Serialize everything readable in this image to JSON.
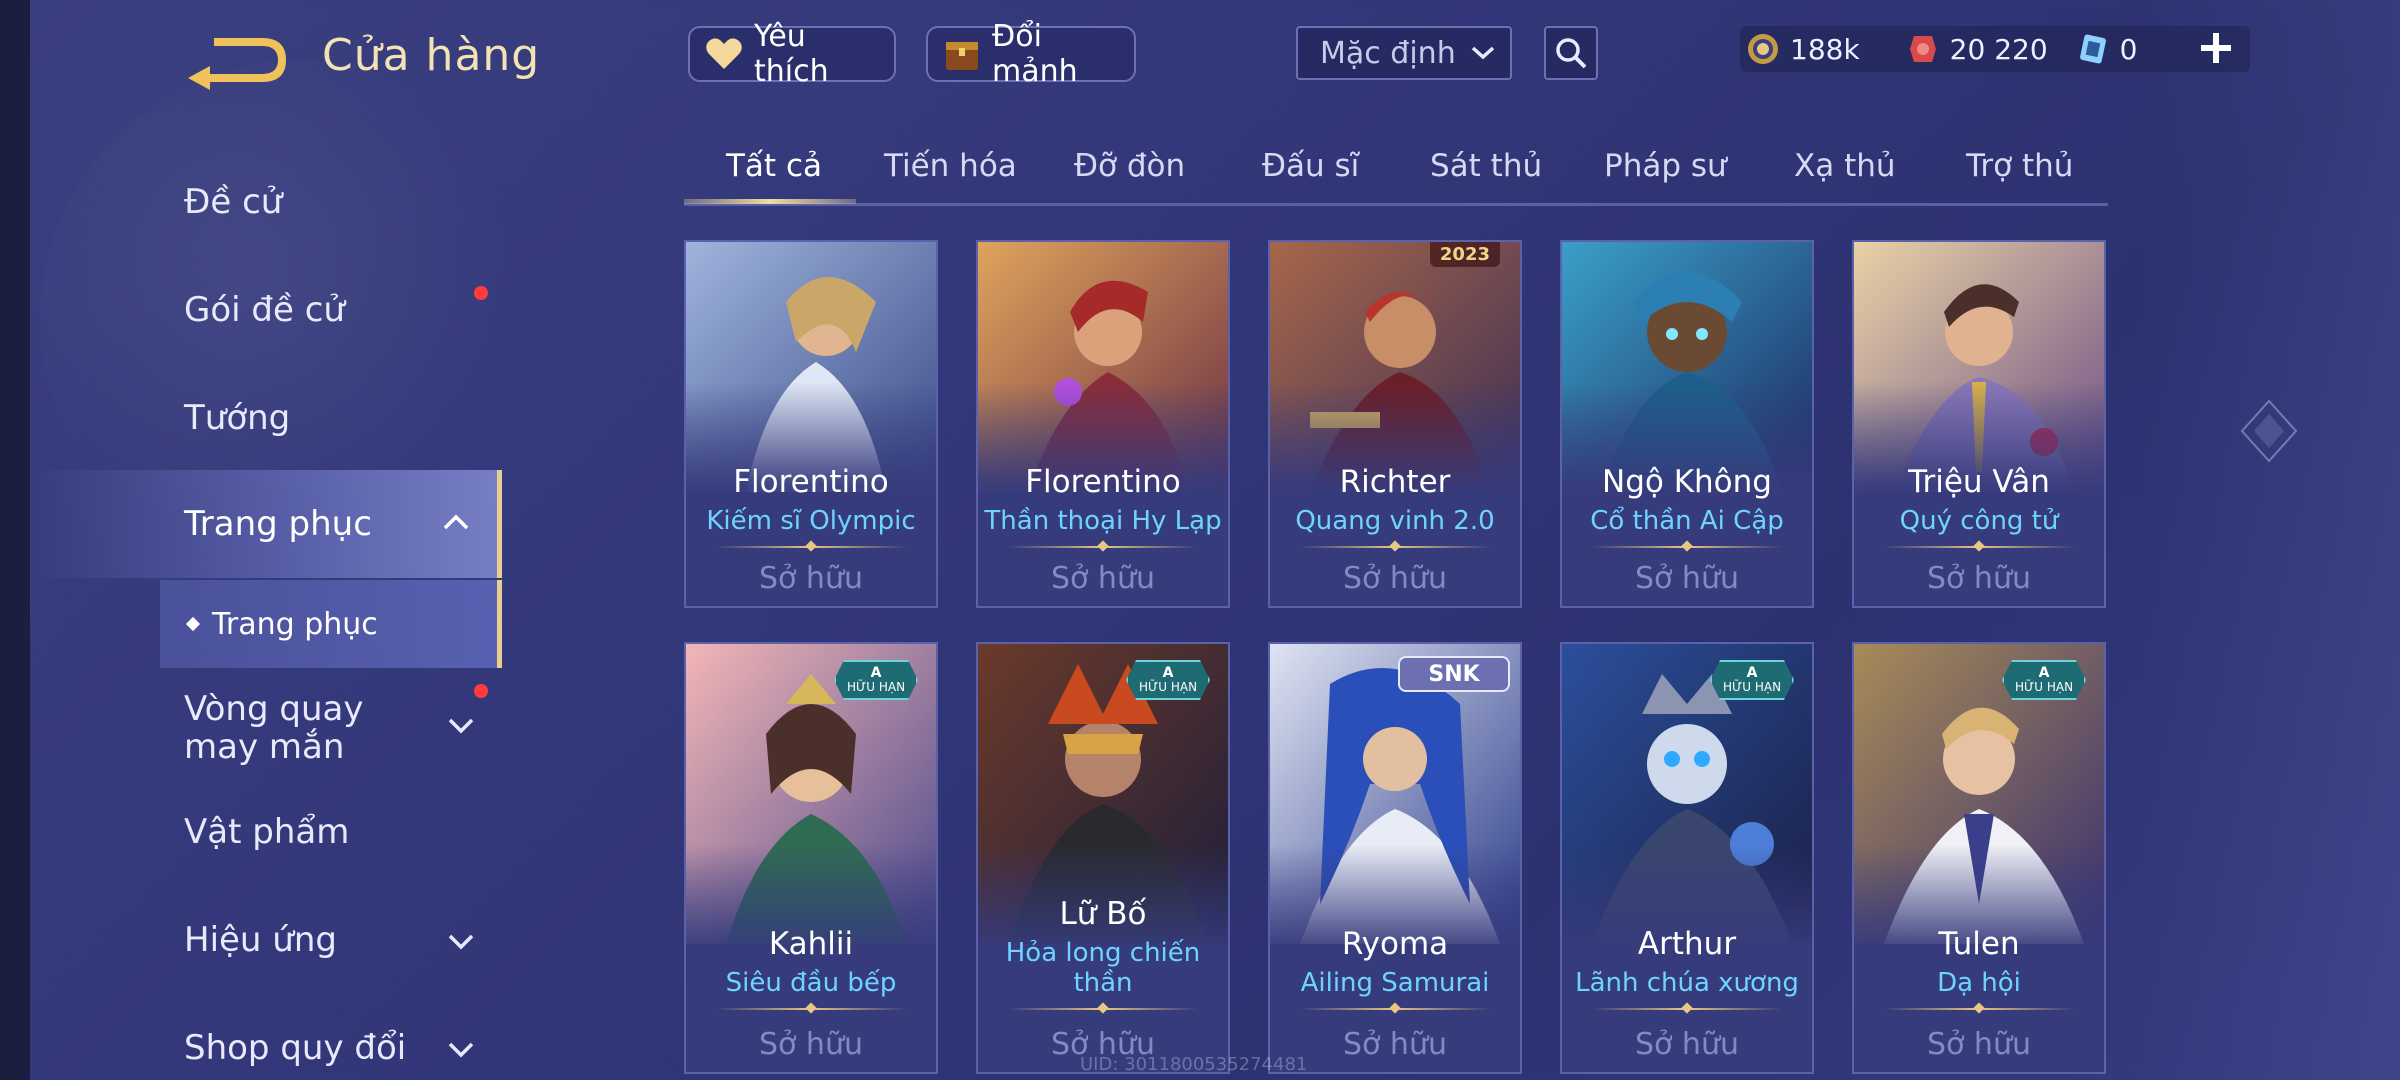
{
  "header": {
    "title": "Cửa hàng",
    "favorite_label": "Yêu thích",
    "shard_label": "Đổi mảnh",
    "sort_value": "Mặc định"
  },
  "currency": {
    "gold": "188k",
    "voucher": "20 220",
    "ticket": "0"
  },
  "sidebar": {
    "items": [
      {
        "label": "Đề cử"
      },
      {
        "label": "Gói đề cử"
      },
      {
        "label": "Tướng"
      },
      {
        "label": "Trang phục"
      },
      {
        "label": "Vòng quay may mắn"
      },
      {
        "label": "Vật phẩm"
      },
      {
        "label": "Hiệu ứng"
      },
      {
        "label": "Shop quy đổi"
      }
    ],
    "sub_item": "Trang phục"
  },
  "tabs": [
    {
      "label": "Tất cả"
    },
    {
      "label": "Tiến hóa"
    },
    {
      "label": "Đỡ đòn"
    },
    {
      "label": "Đấu sĩ"
    },
    {
      "label": "Sát thủ"
    },
    {
      "label": "Pháp sư"
    },
    {
      "label": "Xạ thủ"
    },
    {
      "label": "Trợ thủ"
    }
  ],
  "cards": [
    {
      "hero": "Florentino",
      "skin": "Kiếm sĩ Olympic",
      "status": "Sở hữu"
    },
    {
      "hero": "Florentino",
      "skin": "Thần thoại Hy Lạp",
      "status": "Sở hữu"
    },
    {
      "hero": "Richter",
      "skin": "Quang vinh 2.0",
      "status": "Sở hữu",
      "corner": "2023"
    },
    {
      "hero": "Ngộ Không",
      "skin": "Cổ thần Ai Cập",
      "status": "Sở hữu"
    },
    {
      "hero": "Triệu Vân",
      "skin": "Quý công tử",
      "status": "Sở hữu"
    },
    {
      "hero": "Kahlii",
      "skin": "Siêu đầu bếp",
      "status": "Sở hữu",
      "badge_top": "A",
      "badge_bottom": "HỮU HẠN"
    },
    {
      "hero": "Lữ Bố",
      "skin": "Hỏa long chiến thần",
      "status": "Sở hữu",
      "badge_top": "A",
      "badge_bottom": "HỮU HẠN"
    },
    {
      "hero": "Ryoma",
      "skin": "Ailing Samurai",
      "status": "Sở hữu",
      "snk": "SNK"
    },
    {
      "hero": "Arthur",
      "skin": "Lãnh chúa xương",
      "status": "Sở hữu",
      "badge_top": "A",
      "badge_bottom": "HỮU HẠN"
    },
    {
      "hero": "Tulen",
      "skin": "Dạ hội",
      "status": "Sở hữu",
      "badge_top": "A",
      "badge_bottom": "HỮU HẠN"
    }
  ],
  "footer": {
    "uid": "UID: 3011800535274481"
  },
  "colors": {
    "accent_gold": "#e6cf8f",
    "skin_name_blue": "#6fd3ff",
    "notification_red": "#ff3b3b"
  }
}
